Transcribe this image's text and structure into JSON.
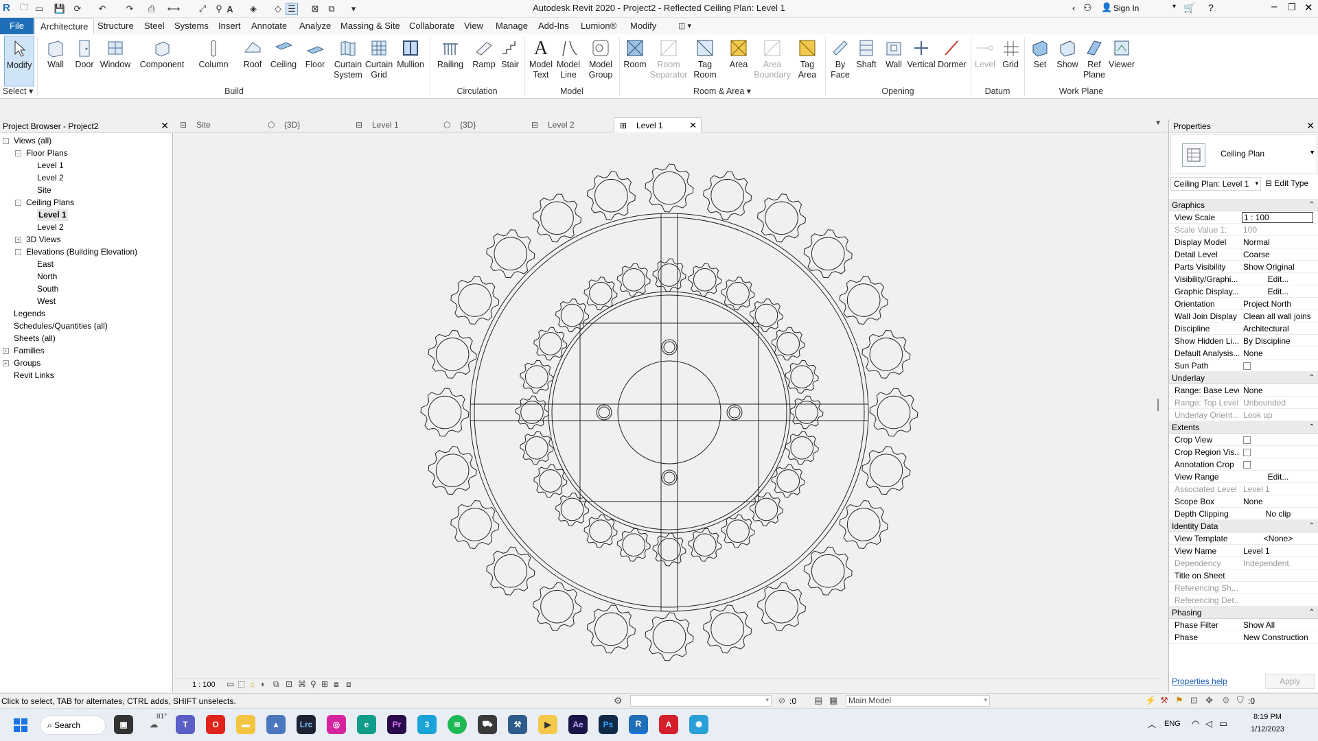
{
  "window": {
    "title": "Autodesk Revit 2020 - Project2 - Reflected Ceiling Plan: Level 1",
    "sign_in": "Sign In"
  },
  "ribbon_tabs": [
    "File",
    "Architecture",
    "Structure",
    "Steel",
    "Systems",
    "Insert",
    "Annotate",
    "Analyze",
    "Massing & Site",
    "Collaborate",
    "View",
    "Manage",
    "Add-Ins",
    "Lumion®",
    "Modify"
  ],
  "ribbon": {
    "tools": {
      "modify": "Modify",
      "wall": "Wall",
      "door": "Door",
      "window": "Window",
      "component": "Component",
      "column": "Column",
      "roof": "Roof",
      "ceiling": "Ceiling",
      "floor": "Floor",
      "curtain_system": "Curtain System",
      "curtain_grid": "Curtain Grid",
      "mullion": "Mullion",
      "railing": "Railing",
      "ramp": "Ramp",
      "stair": "Stair",
      "model_text": "Model Text",
      "model_line": "Model Line",
      "model_group": "Model Group",
      "room": "Room",
      "room_separator": "Room Separator",
      "tag_room": "Tag Room",
      "area": "Area",
      "area_boundary": "Area Boundary",
      "tag_area": "Tag Area",
      "by_face": "By Face",
      "shaft": "Shaft",
      "wall_opening": "Wall",
      "vertical": "Vertical",
      "dormer": "Dormer",
      "level": "Level",
      "grid": "Grid",
      "set": "Set",
      "show": "Show",
      "ref_plane": "Ref Plane",
      "viewer": "Viewer"
    },
    "panels": {
      "select": "Select",
      "build": "Build",
      "circulation": "Circulation",
      "model": "Model",
      "room_area": "Room & Area",
      "opening": "Opening",
      "datum": "Datum",
      "work_plane": "Work Plane"
    }
  },
  "project_browser": {
    "title": "Project Browser - Project2",
    "items": [
      {
        "label": "Views (all)",
        "level": 0,
        "toggle": "-"
      },
      {
        "label": "Floor Plans",
        "level": 1,
        "toggle": "-"
      },
      {
        "label": "Level 1",
        "level": 2
      },
      {
        "label": "Level 2",
        "level": 2
      },
      {
        "label": "Site",
        "level": 2
      },
      {
        "label": "Ceiling Plans",
        "level": 1,
        "toggle": "-"
      },
      {
        "label": "Level 1",
        "level": 2,
        "bold": true
      },
      {
        "label": "Level 2",
        "level": 2
      },
      {
        "label": "3D Views",
        "level": 1,
        "toggle": "+"
      },
      {
        "label": "Elevations (Building Elevation)",
        "level": 1,
        "toggle": "-"
      },
      {
        "label": "East",
        "level": 2
      },
      {
        "label": "North",
        "level": 2
      },
      {
        "label": "South",
        "level": 2
      },
      {
        "label": "West",
        "level": 2
      },
      {
        "label": "Legends",
        "level": 0
      },
      {
        "label": "Schedules/Quantities (all)",
        "level": 0
      },
      {
        "label": "Sheets (all)",
        "level": 0
      },
      {
        "label": "Families",
        "level": 0,
        "toggle": "+"
      },
      {
        "label": "Groups",
        "level": 0,
        "toggle": "+"
      },
      {
        "label": "Revit Links",
        "level": 0
      }
    ]
  },
  "view_tabs": [
    "Site",
    "{3D}",
    "Level 1",
    "{3D}",
    "Level 2",
    "Level 1"
  ],
  "view_bar": {
    "scale": "1 : 100"
  },
  "properties": {
    "title": "Properties",
    "type_name": "Ceiling Plan",
    "instance": "Ceiling Plan: Level 1",
    "edit_type": "Edit Type",
    "sections": [
      {
        "name": "Graphics",
        "rows": [
          {
            "label": "View Scale",
            "value": "1 : 100",
            "boxed": true
          },
          {
            "label": "Scale Value    1:",
            "value": "100",
            "dim": true
          },
          {
            "label": "Display Model",
            "value": "Normal"
          },
          {
            "label": "Detail Level",
            "value": "Coarse"
          },
          {
            "label": "Parts Visibility",
            "value": "Show Original"
          },
          {
            "label": "Visibility/Graphi...",
            "value": "Edit...",
            "button": true
          },
          {
            "label": "Graphic Display...",
            "value": "Edit...",
            "button": true
          },
          {
            "label": "Orientation",
            "value": "Project North"
          },
          {
            "label": "Wall Join Display",
            "value": "Clean all wall joins"
          },
          {
            "label": "Discipline",
            "value": "Architectural"
          },
          {
            "label": "Show Hidden Li...",
            "value": "By Discipline"
          },
          {
            "label": "Default Analysis...",
            "value": "None"
          },
          {
            "label": "Sun Path",
            "value": "",
            "checkbox": true
          }
        ]
      },
      {
        "name": "Underlay",
        "rows": [
          {
            "label": "Range: Base Level",
            "value": "None"
          },
          {
            "label": "Range: Top Level",
            "value": "Unbounded",
            "dim": true
          },
          {
            "label": "Underlay Orient...",
            "value": "Look up",
            "dim": true
          }
        ]
      },
      {
        "name": "Extents",
        "rows": [
          {
            "label": "Crop View",
            "value": "",
            "checkbox": true
          },
          {
            "label": "Crop Region Vis...",
            "value": "",
            "checkbox": true
          },
          {
            "label": "Annotation Crop",
            "value": "",
            "checkbox": true
          },
          {
            "label": "View Range",
            "value": "Edit...",
            "button": true
          },
          {
            "label": "Associated Level",
            "value": "Level 1",
            "dim": true
          },
          {
            "label": "Scope Box",
            "value": "None"
          },
          {
            "label": "Depth Clipping",
            "value": "No clip",
            "button": true
          }
        ]
      },
      {
        "name": "Identity Data",
        "rows": [
          {
            "label": "View Template",
            "value": "<None>",
            "button": true
          },
          {
            "label": "View Name",
            "value": "Level 1"
          },
          {
            "label": "Dependency",
            "value": "Independent",
            "dim": true
          },
          {
            "label": "Title on Sheet",
            "value": ""
          },
          {
            "label": "Referencing Sh...",
            "value": "",
            "dim": true
          },
          {
            "label": "Referencing Det...",
            "value": "",
            "dim": true
          }
        ]
      },
      {
        "name": "Phasing",
        "rows": [
          {
            "label": "Phase Filter",
            "value": "Show All"
          },
          {
            "label": "Phase",
            "value": "New Construction"
          }
        ]
      }
    ],
    "help_link": "Properties help",
    "apply": "Apply"
  },
  "status": {
    "message": "Click to select, TAB for alternates, CTRL adds, SHIFT unselects.",
    "count": ":0",
    "model": "Main Model",
    "filter_count": ":0"
  },
  "taskbar": {
    "search": "Search",
    "temp": "81°",
    "lang": "ENG",
    "time": "8:19 PM",
    "date": "1/12/2023"
  },
  "colors": {
    "file_tab": "#1f6fb8",
    "select_highlight": "#cfe4f7",
    "link": "#1a5fb4"
  }
}
